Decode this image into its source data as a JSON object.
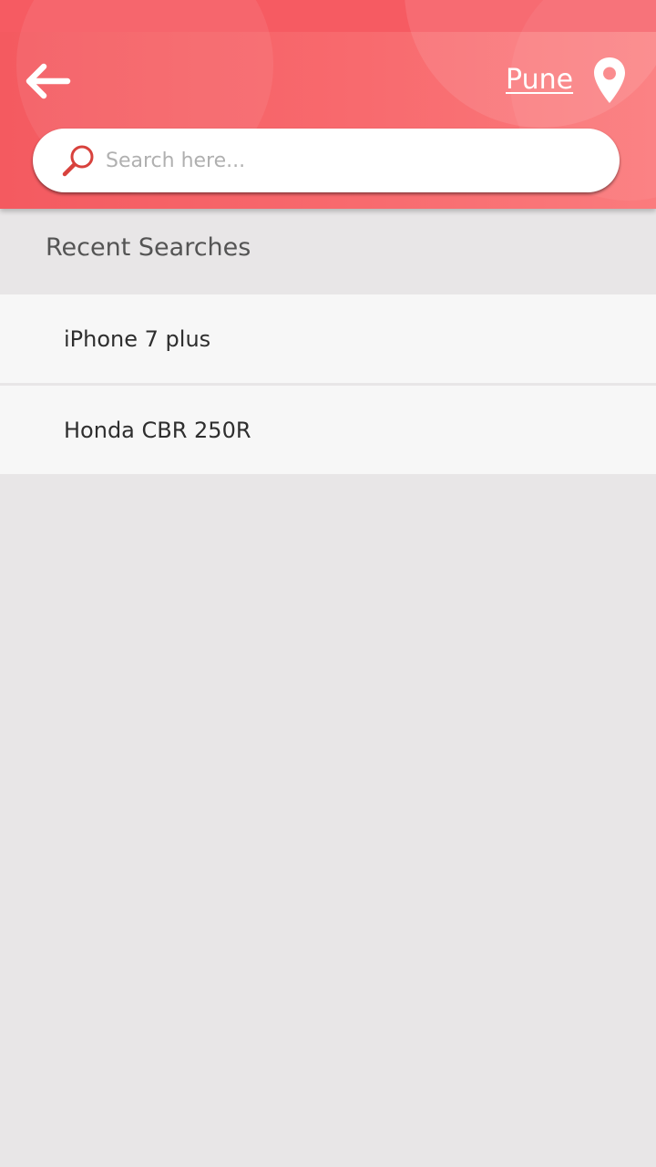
{
  "header": {
    "city": "Pune",
    "back_icon": "arrow-left-icon",
    "location_icon": "map-pin-icon",
    "accent_color": "#f65b62"
  },
  "search": {
    "placeholder": "Search here...",
    "value": "",
    "icon": "search-icon"
  },
  "recent": {
    "title": "Recent Searches",
    "items": [
      {
        "label": "iPhone 7 plus"
      },
      {
        "label": "Honda CBR 250R"
      }
    ]
  }
}
